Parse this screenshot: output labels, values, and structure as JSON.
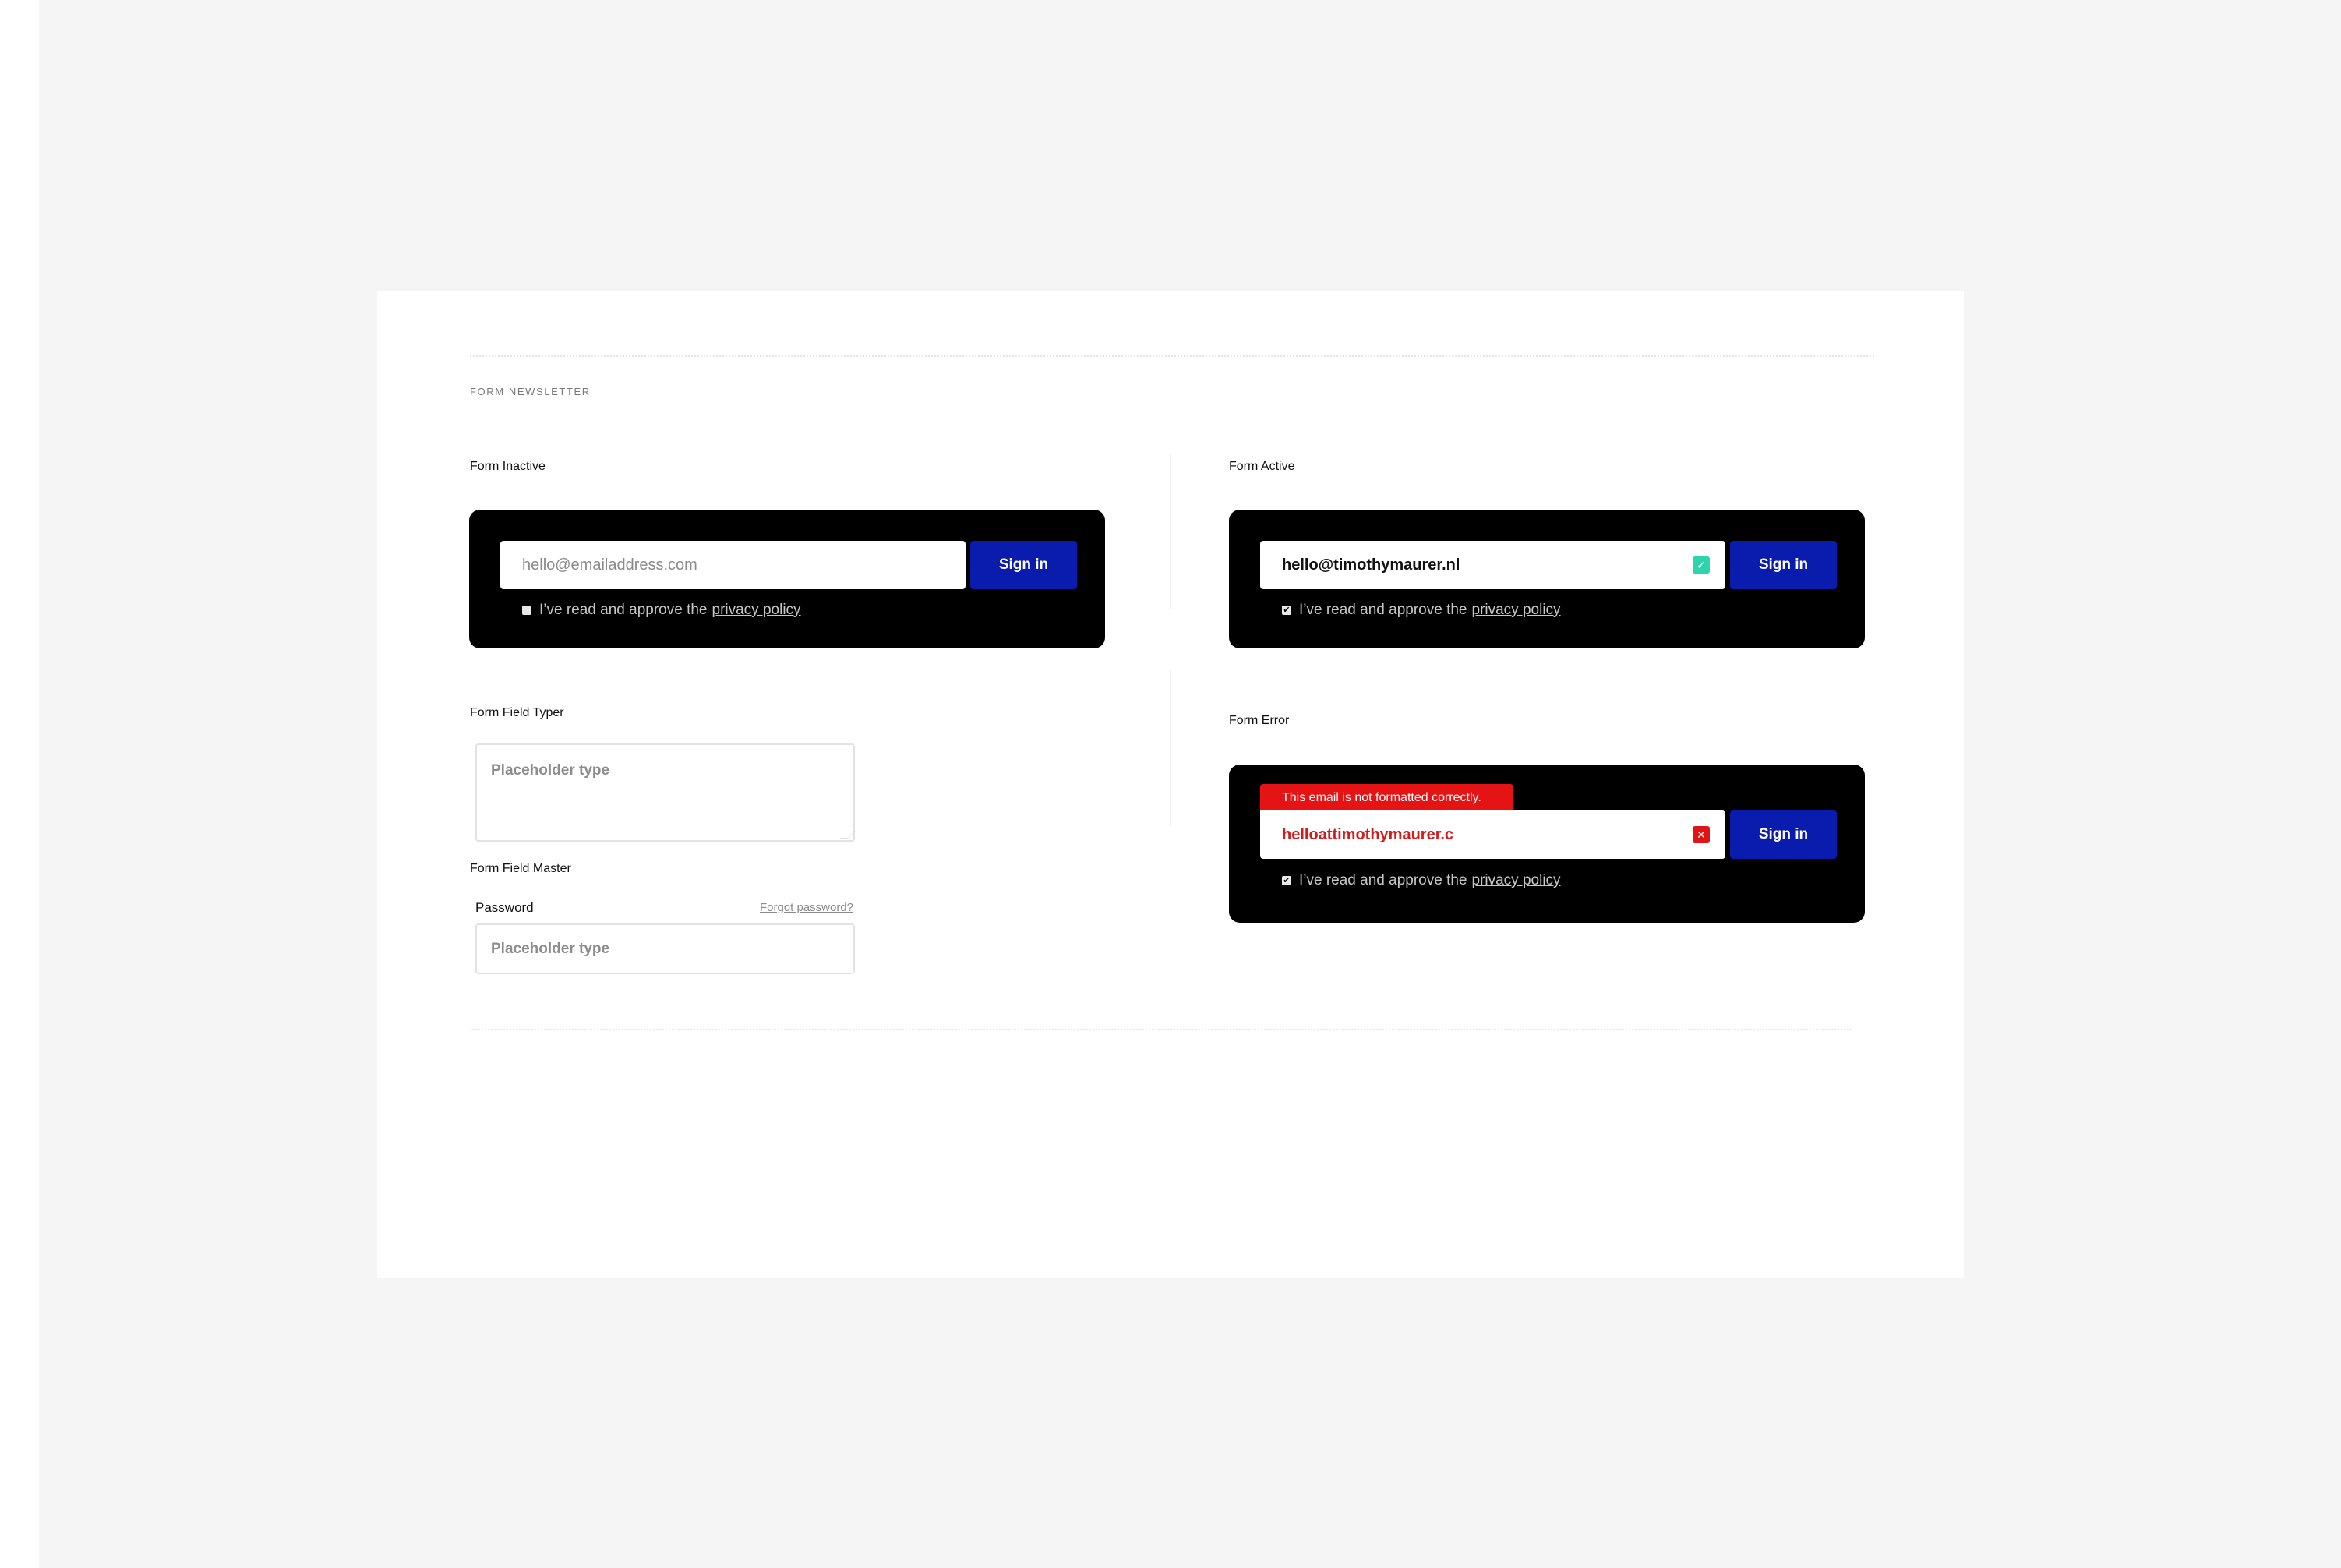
{
  "section": {
    "title": "FORM NEWSLETTER"
  },
  "inactive": {
    "label": "Form Inactive",
    "email_placeholder": "hello@emailaddress.com",
    "button": "Sign in",
    "consent_text": "I’ve read and approve the",
    "consent_link": "privacy policy",
    "consent_checked": false
  },
  "active": {
    "label": "Form Active",
    "email_value": "hello@timothymaurer.nl",
    "status_icon": "check-icon",
    "status_color": "#2dd4ad",
    "button": "Sign in",
    "consent_text": "I’ve read and approve the",
    "consent_link": "privacy policy",
    "consent_checked": true
  },
  "typer": {
    "label": "Form Field Typer",
    "placeholder": "Placeholder type"
  },
  "master": {
    "label": "Form Field Master",
    "field_label": "Password",
    "forgot_link": "Forgot password?",
    "placeholder": "Placeholder type"
  },
  "error": {
    "label": "Form Error",
    "message": "This email is not formatted correctly.",
    "email_value": "helloattimothymaurer.c",
    "status_icon": "close-icon",
    "status_color": "#e01414",
    "button": "Sign in",
    "consent_text": "I’ve read and approve the",
    "consent_link": "privacy policy",
    "consent_checked": true
  },
  "colors": {
    "button_blue": "#0a1cae",
    "error_red": "#e51313",
    "valid_teal": "#2dd4ad",
    "panel_black": "#000000"
  },
  "icons": {
    "checkmark": "✓",
    "cross": "✕",
    "tick": "✔"
  }
}
